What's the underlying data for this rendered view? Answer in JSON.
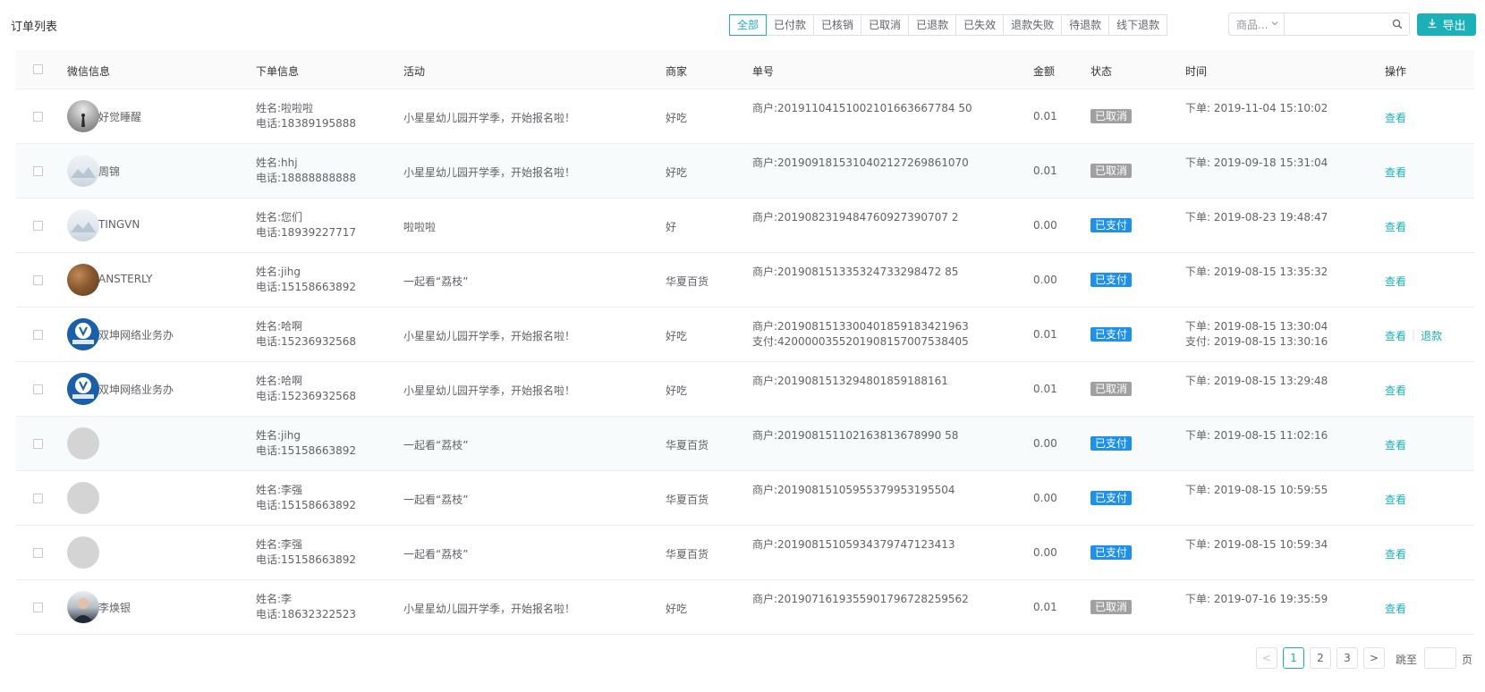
{
  "page": {
    "title": "订单列表"
  },
  "filters": [
    {
      "label": "全部",
      "active": true
    },
    {
      "label": "已付款"
    },
    {
      "label": "已核销"
    },
    {
      "label": "已取消"
    },
    {
      "label": "已退款"
    },
    {
      "label": "已失效"
    },
    {
      "label": "退款失败"
    },
    {
      "label": "待退款"
    },
    {
      "label": "线下退款"
    }
  ],
  "search": {
    "select_value": "商品...",
    "input_value": "",
    "placeholder": ""
  },
  "toolbar": {
    "export_label": "导出"
  },
  "table": {
    "headers": {
      "wechat": "微信信息",
      "order_info": "下单信息",
      "activity": "活动",
      "merchant": "商家",
      "order_no": "单号",
      "amount": "金额",
      "status": "状态",
      "time": "时间",
      "actions": "操作"
    },
    "rows": [
      {
        "avatar": "dusk",
        "wx_name": "好觉睡醒",
        "name": "姓名:啦啦啦",
        "phone": "电话:18389195888",
        "activity": "小星星幼儿园开学季，开始报名啦！",
        "merchant": "好吃",
        "order_no": "商户:20191104151002101663667784 50",
        "pay_no": "",
        "amount": "0.01",
        "status": "已取消",
        "status_type": "cancelled",
        "order_time": "下单: 2019-11-04 15:10:02",
        "pay_time": "",
        "actions": [
          "查看"
        ]
      },
      {
        "avatar": "light",
        "wx_name": "周锦",
        "name": "姓名:hhj",
        "phone": "电话:18888888888",
        "activity": "小星星幼儿园开学季，开始报名啦！",
        "merchant": "好吃",
        "order_no": "商户:2019091815310402127269861070",
        "pay_no": "",
        "amount": "0.01",
        "status": "已取消",
        "status_type": "cancelled",
        "order_time": "下单: 2019-09-18 15:31:04",
        "pay_time": "",
        "actions": [
          "查看"
        ]
      },
      {
        "avatar": "light",
        "wx_name": "TINGVN",
        "name": "姓名:您们",
        "phone": "电话:18939227717",
        "activity": "啦啦啦",
        "merchant": "好",
        "order_no": "商户:2019082319484760927390707 2",
        "pay_no": "",
        "amount": "0.00",
        "status": "已支付",
        "status_type": "paid",
        "order_time": "下单: 2019-08-23 19:48:47",
        "pay_time": "",
        "actions": [
          "查看"
        ]
      },
      {
        "avatar": "wood",
        "wx_name": "ANSTERLY",
        "name": "姓名:jihg",
        "phone": "电话:15158663892",
        "activity": "一起看“荔枝”",
        "merchant": "华夏百货",
        "order_no": "商户:201908151335324733298472 85",
        "pay_no": "",
        "amount": "0.00",
        "status": "已支付",
        "status_type": "paid",
        "order_time": "下单: 2019-08-15 13:35:32",
        "pay_time": "",
        "actions": [
          "查看"
        ]
      },
      {
        "avatar": "brand",
        "wx_name": "双坤网络业务办",
        "name": "姓名:哈啊",
        "phone": "电话:15236932568",
        "activity": "小星星幼儿园开学季，开始报名啦！",
        "merchant": "好吃",
        "order_no": "商户:2019081513300401859183421963",
        "pay_no": "支付:4200000355201908157007538405",
        "amount": "0.01",
        "status": "已支付",
        "status_type": "paid",
        "order_time": "下单: 2019-08-15 13:30:04",
        "pay_time": "支付: 2019-08-15 13:30:16",
        "actions": [
          "查看",
          "退款"
        ]
      },
      {
        "avatar": "brand",
        "wx_name": "双坤网络业务办",
        "name": "姓名:哈啊",
        "phone": "电话:15236932568",
        "activity": "小星星幼儿园开学季，开始报名啦！",
        "merchant": "好吃",
        "order_no": "商户:2019081513294801859188161",
        "pay_no": "",
        "amount": "0.01",
        "status": "已取消",
        "status_type": "cancelled",
        "order_time": "下单: 2019-08-15 13:29:48",
        "pay_time": "",
        "actions": [
          "查看"
        ]
      },
      {
        "avatar": "empty",
        "wx_name": "",
        "name": "姓名:jihg",
        "phone": "电话:15158663892",
        "activity": "一起看“荔枝”",
        "merchant": "华夏百货",
        "order_no": "商户:201908151102163813678990 58",
        "pay_no": "",
        "amount": "0.00",
        "status": "已支付",
        "status_type": "paid",
        "order_time": "下单: 2019-08-15 11:02:16",
        "pay_time": "",
        "actions": [
          "查看"
        ]
      },
      {
        "avatar": "empty",
        "wx_name": "",
        "name": "姓名:李强",
        "phone": "电话:15158663892",
        "activity": "一起看“荔枝”",
        "merchant": "华夏百货",
        "order_no": "商户:20190815105955379953195504",
        "pay_no": "",
        "amount": "0.00",
        "status": "已支付",
        "status_type": "paid",
        "order_time": "下单: 2019-08-15 10:59:55",
        "pay_time": "",
        "actions": [
          "查看"
        ]
      },
      {
        "avatar": "empty",
        "wx_name": "",
        "name": "姓名:李强",
        "phone": "电话:15158663892",
        "activity": "一起看“荔枝”",
        "merchant": "华夏百货",
        "order_no": "商户:20190815105934379747123413",
        "pay_no": "",
        "amount": "0.00",
        "status": "已支付",
        "status_type": "paid",
        "order_time": "下单: 2019-08-15 10:59:34",
        "pay_time": "",
        "actions": [
          "查看"
        ]
      },
      {
        "avatar": "person",
        "wx_name": "李焕银",
        "name": "姓名:李",
        "phone": "电话:18632322523",
        "activity": "小星星幼儿园开学季，开始报名啦！",
        "merchant": "好吃",
        "order_no": "商户:2019071619355901796728259562",
        "pay_no": "",
        "amount": "0.01",
        "status": "已取消",
        "status_type": "cancelled",
        "order_time": "下单: 2019-07-16 19:35:59",
        "pay_time": "",
        "actions": [
          "查看"
        ]
      }
    ]
  },
  "pagination": {
    "prev": "<",
    "pages": [
      "1",
      "2",
      "3"
    ],
    "current": "1",
    "next": ">",
    "jump_label": "跳至",
    "jump_suffix": "页"
  },
  "colors": {
    "accent": "#1cb0b8",
    "paid": "#1e90e8",
    "cancelled": "#a0a0a0"
  },
  "icons": {
    "search": "search-icon",
    "export": "download-icon",
    "select": "chevron-down-icon"
  }
}
